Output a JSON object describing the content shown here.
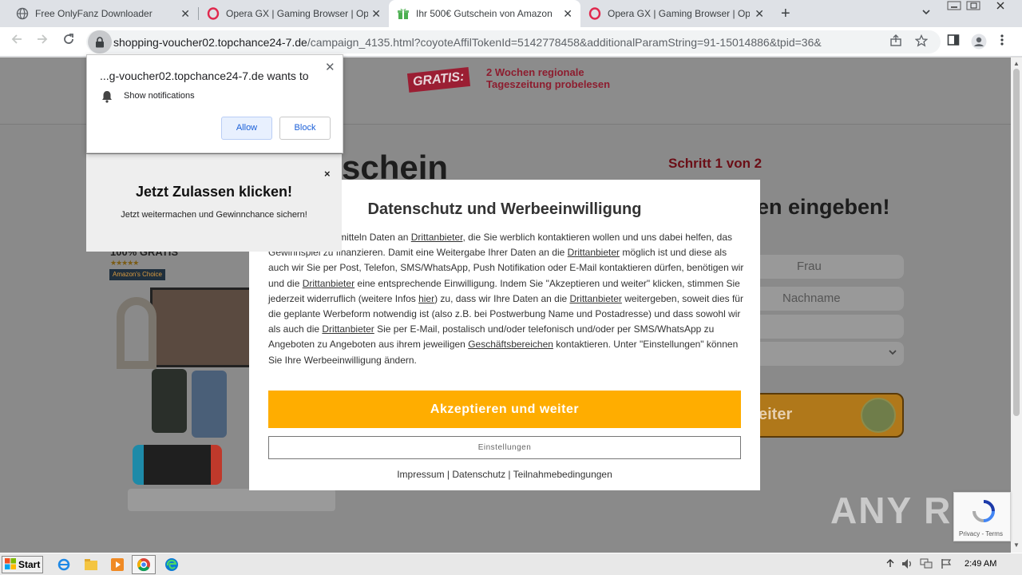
{
  "browser": {
    "tabs": [
      {
        "title": "Free OnlyFanz Downloader",
        "icon": "globe-icon",
        "active": false
      },
      {
        "title": "Opera GX | Gaming Browser | Opera",
        "icon": "opera-icon",
        "active": false
      },
      {
        "title": "Ihr 500€ Gutschein von Amazon",
        "icon": "gift-icon",
        "active": true
      },
      {
        "title": "Opera GX | Gaming Browser | Opera",
        "icon": "opera-icon",
        "active": false
      }
    ],
    "url_host": "shopping-voucher02.topchance24-7.de",
    "url_path": "/campaign_4135.html?coyoteAffilTokenId=5142778458&additionalParamString=91-15014886&tpid=36&"
  },
  "permission_prompt": {
    "site": "...g-voucher02.topchance24-7.de wants to",
    "permission": "Show notifications",
    "allow": "Allow",
    "block": "Block"
  },
  "helper_popup": {
    "close": "×",
    "title": "Jetzt Zulassen klicken!",
    "subtitle": "Jetzt weitermachen und Gewinnchance sichern!"
  },
  "page": {
    "gratis_badge": "GRATIS:",
    "gratis_line1": "2 Wochen regionale",
    "gratis_line2": "Tageszeitung probelesen",
    "heading_fragment": "schein",
    "step": "Schritt 1 von 2",
    "eingeben": "en eingeben!",
    "field_salutation": "Frau",
    "field_lastname": "Nachname",
    "submit_fragment": "eiter",
    "gratis100": "100% GRATIS",
    "stars": "★★★★★",
    "amazon_choice": "Amazon's Choice"
  },
  "modal": {
    "title": "Datenschutz und Werbeeinwilligung",
    "body_parts": {
      "p1": "Die Partner übermitteln Daten an ",
      "link1": "Drittanbieter",
      "p2": ", die Sie werblich kontaktieren wollen und uns dabei helfen, das Gewinnspiel zu finanzieren. Damit eine Weitergabe Ihrer Daten an die ",
      "link2": "Drittanbieter",
      "p3": " möglich ist und diese als auch wir Sie per Post, Telefon, SMS/WhatsApp, Push Notifikation oder E-Mail kontaktieren dürfen, benötigen wir und die ",
      "link3": "Drittanbieter",
      "p4": " eine entsprechende Einwilligung. Indem Sie \"Akzeptieren und weiter\" klicken, stimmen Sie jederzeit widerruflich (weitere Infos ",
      "link4": "hier",
      "p5": ") zu, dass wir Ihre Daten an die ",
      "link5": "Drittanbieter",
      "p6": " weitergeben, soweit dies für die geplante Werbeform notwendig ist (also z.B. bei Postwerbung Name und Postadresse) und dass sowohl wir als auch die ",
      "link6": "Drittanbieter",
      "p7": " Sie per E-Mail, postalisch und/oder telefonisch und/oder per SMS/WhatsApp zu Angeboten zu Angeboten aus ihrem jeweiligen ",
      "link7": "Geschäftsbereichen",
      "p8": " kontaktieren. Unter \"Einstellungen\" können Sie Ihre Werbeeinwilligung ändern."
    },
    "accept_button": "Akzeptieren und weiter",
    "settings_button": "Einstellungen",
    "footer": {
      "impressum": "Impressum",
      "sep": "|",
      "datenschutz": "Datenschutz",
      "teilnahme": "Teilnahmebedingungen"
    }
  },
  "recaptcha": {
    "terms": "Privacy - Terms"
  },
  "watermark": "ANY RUN",
  "taskbar": {
    "start": "Start",
    "clock": "2:49 AM"
  },
  "colors": {
    "accept": "#ffad00",
    "accent_red": "#9b1e33",
    "overlay_gray": "#8a8a8a"
  }
}
